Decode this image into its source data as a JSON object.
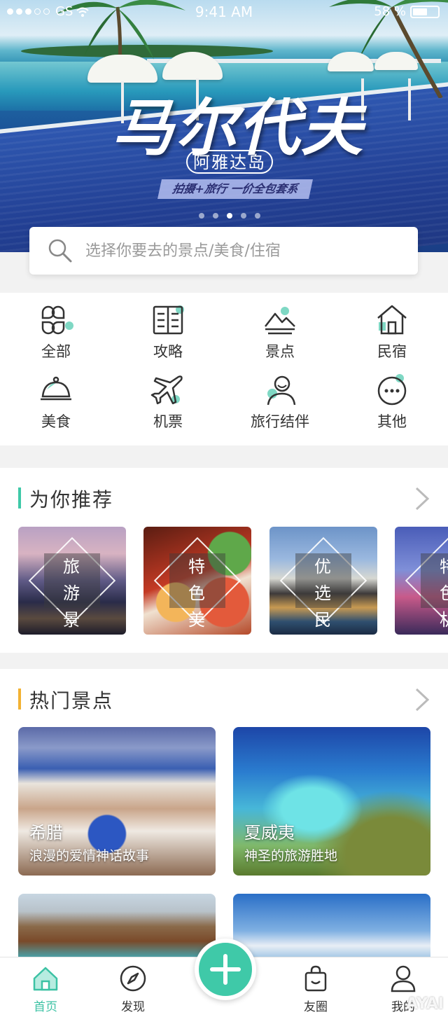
{
  "status_bar": {
    "carrier": "GS",
    "time": "9:41 AM",
    "battery": "58 %",
    "battery_level": 0.58
  },
  "hero": {
    "title": "马尔代夫",
    "subtitle": "阿雅达岛",
    "tagline": "拍摄+旅行 一价全包套系",
    "slide_count": 5,
    "active_slide": 3
  },
  "search": {
    "placeholder": "选择你要去的景点/美食/住宿"
  },
  "categories": [
    {
      "label": "全部",
      "icon": "clover-grid-icon"
    },
    {
      "label": "攻略",
      "icon": "book-icon"
    },
    {
      "label": "景点",
      "icon": "mountain-icon"
    },
    {
      "label": "民宿",
      "icon": "house-icon"
    },
    {
      "label": "美食",
      "icon": "food-cloche-icon"
    },
    {
      "label": "机票",
      "icon": "airplane-icon"
    },
    {
      "label": "旅行结伴",
      "icon": "companion-icon"
    },
    {
      "label": "其他",
      "icon": "more-dots-icon"
    }
  ],
  "recommend": {
    "title": "为你推荐",
    "items": [
      {
        "line1": "旅游",
        "line2": "景点"
      },
      {
        "line1": "特色",
        "line2": "美食"
      },
      {
        "line1": "优选",
        "line2": "民宿"
      },
      {
        "line1": "特色",
        "line2": "机票"
      }
    ]
  },
  "hot": {
    "title": "热门景点",
    "items": [
      {
        "name": "希腊",
        "desc": "浪漫的爱情神话故事"
      },
      {
        "name": "夏威夷",
        "desc": "神圣的旅游胜地"
      }
    ]
  },
  "tabbar": {
    "items": [
      {
        "label": "首页",
        "icon": "home-icon",
        "active": true
      },
      {
        "label": "发现",
        "icon": "compass-icon"
      },
      {
        "label": "友圈",
        "icon": "bag-icon"
      },
      {
        "label": "我的",
        "icon": "user-icon"
      }
    ],
    "fab_icon": "plus-icon"
  },
  "colors": {
    "accent": "#3fc9a8",
    "recommend_bar": "#3fc9a8",
    "hot_bar": "#f2b233"
  },
  "watermark": "AYAI"
}
